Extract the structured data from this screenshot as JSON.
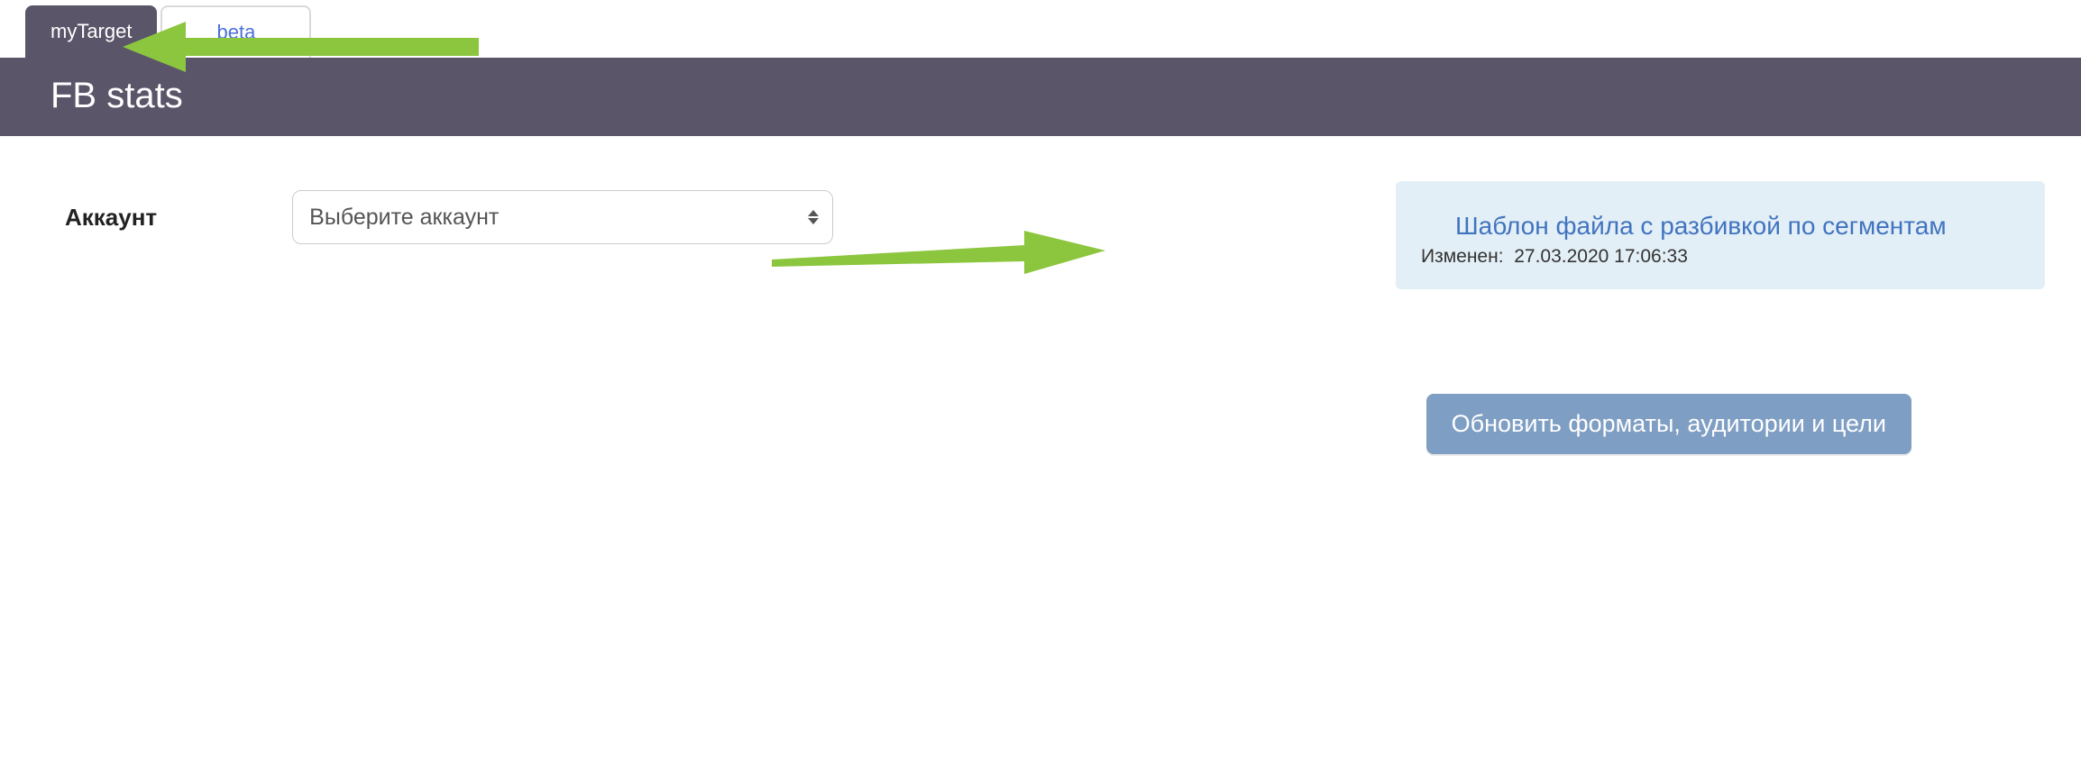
{
  "tabs": {
    "active": "myTarget",
    "inactive": "beta"
  },
  "header": {
    "title": "FB stats"
  },
  "form": {
    "account_label": "Аккаунт",
    "account_placeholder": "Выберите аккаунт"
  },
  "template_box": {
    "link": "Шаблон файла с разбивкой по сегментам",
    "meta_label": "Изменен:",
    "meta_value": "27.03.2020 17:06:33"
  },
  "buttons": {
    "update": "Обновить форматы, аудитории и цели"
  }
}
